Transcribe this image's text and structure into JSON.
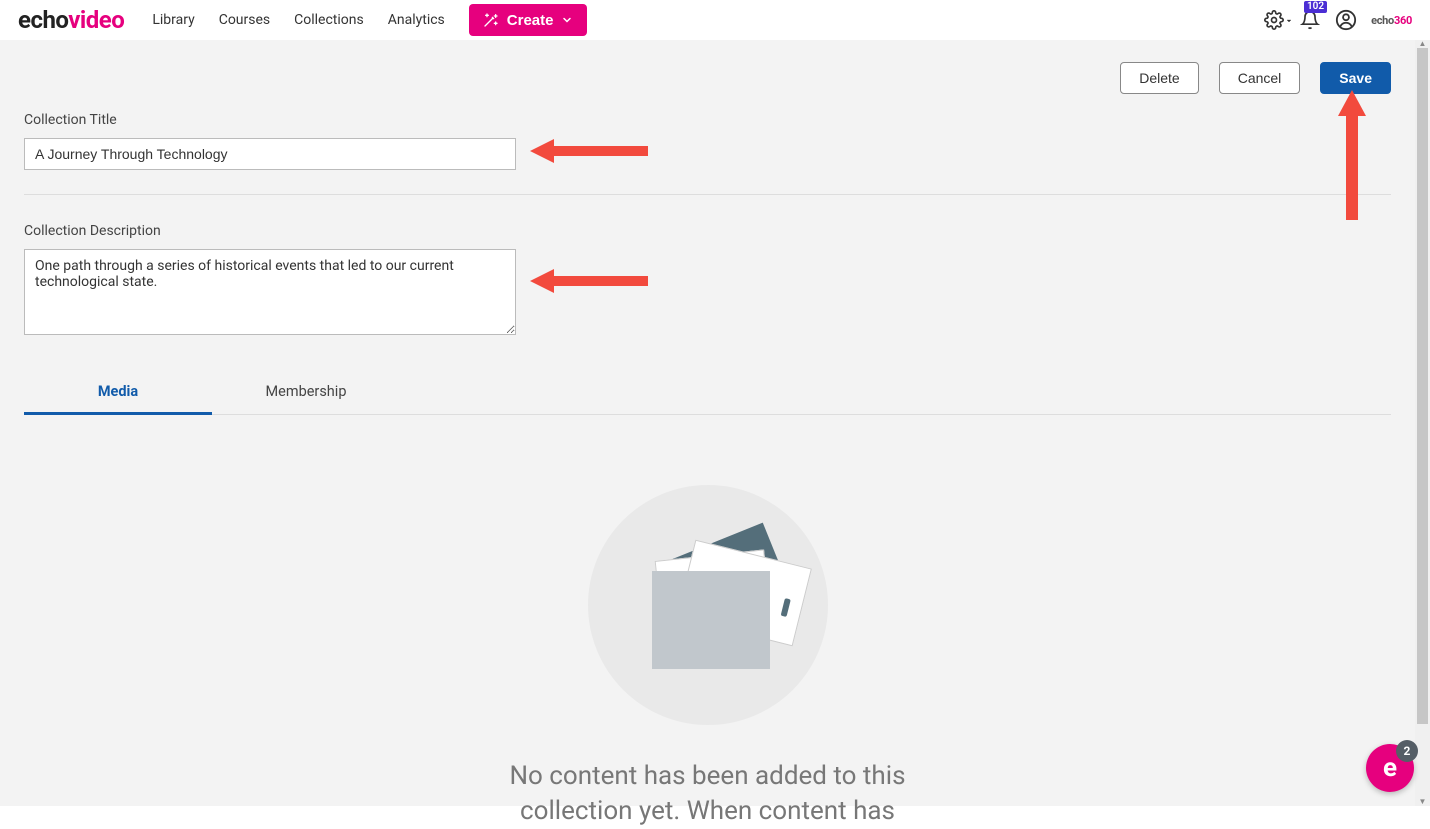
{
  "brand": {
    "part1": "echo",
    "part2": "video"
  },
  "nav": {
    "library": "Library",
    "courses": "Courses",
    "collections": "Collections",
    "analytics": "Analytics",
    "create": "Create"
  },
  "notifications": {
    "count": "102"
  },
  "echo360": {
    "part1": "echo",
    "part2": "360"
  },
  "actions": {
    "delete": "Delete",
    "cancel": "Cancel",
    "save": "Save"
  },
  "form": {
    "title_label": "Collection Title",
    "title_value": "A Journey Through Technology",
    "desc_label": "Collection Description",
    "desc_value": "One path through a series of historical events that led to our current technological state."
  },
  "tabs": {
    "media": "Media",
    "membership": "Membership"
  },
  "empty": {
    "line1": "No content has been added to this",
    "line2": "collection yet. When content has"
  },
  "chat": {
    "glyph": "e",
    "count": "2"
  }
}
